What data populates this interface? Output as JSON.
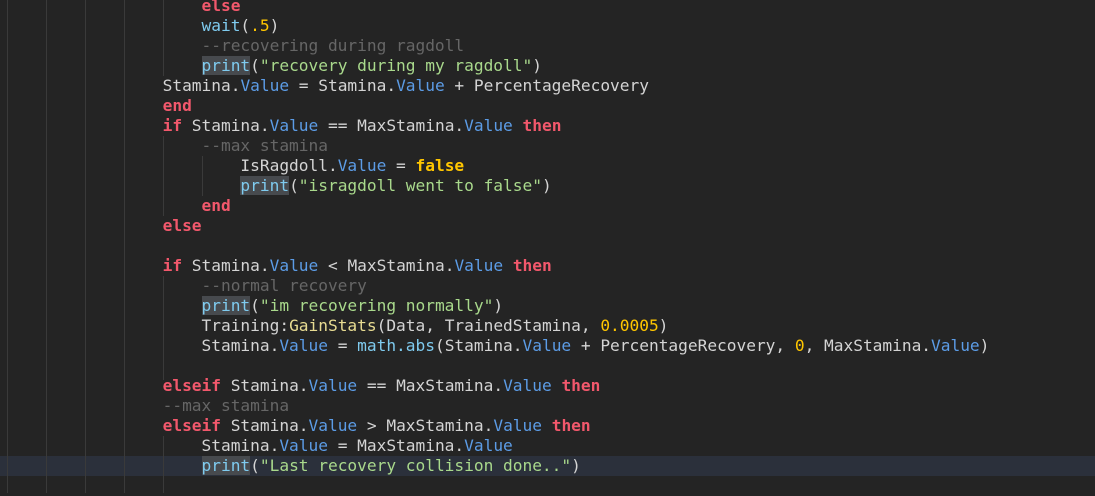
{
  "editor": {
    "current_line": 23,
    "lines": [
      {
        "indent": 20,
        "tokens": [
          [
            "kw",
            "else"
          ]
        ]
      },
      {
        "indent": 20,
        "tokens": [
          [
            "fn",
            "wait"
          ],
          [
            "txt",
            "("
          ],
          [
            "num",
            ".5"
          ],
          [
            "txt",
            ")"
          ]
        ]
      },
      {
        "indent": 20,
        "tokens": [
          [
            "com",
            "--recovering during ragdoll"
          ]
        ]
      },
      {
        "indent": 20,
        "tokens": [
          [
            "fnhl",
            "print"
          ],
          [
            "txt",
            "("
          ],
          [
            "str",
            "\"recovery during my ragdoll\""
          ],
          [
            "txt",
            ")"
          ]
        ]
      },
      {
        "indent": 16,
        "tokens": [
          [
            "txt",
            "Stamina."
          ],
          [
            "prop",
            "Value"
          ],
          [
            "txt",
            " = Stamina."
          ],
          [
            "prop",
            "Value"
          ],
          [
            "txt",
            " + PercentageRecovery"
          ]
        ]
      },
      {
        "indent": 16,
        "tokens": [
          [
            "kw",
            "end"
          ]
        ]
      },
      {
        "indent": 16,
        "tokens": [
          [
            "kw",
            "if"
          ],
          [
            "txt",
            " Stamina."
          ],
          [
            "prop",
            "Value"
          ],
          [
            "txt",
            " == MaxStamina."
          ],
          [
            "prop",
            "Value"
          ],
          [
            "txt",
            " "
          ],
          [
            "kw",
            "then"
          ]
        ]
      },
      {
        "indent": 20,
        "tokens": [
          [
            "com",
            "--max stamina"
          ]
        ]
      },
      {
        "indent": 24,
        "tokens": [
          [
            "txt",
            "IsRagdoll."
          ],
          [
            "prop",
            "Value"
          ],
          [
            "txt",
            " = "
          ],
          [
            "bool",
            "false"
          ]
        ]
      },
      {
        "indent": 24,
        "tokens": [
          [
            "fnhl",
            "print"
          ],
          [
            "txt",
            "("
          ],
          [
            "str",
            "\"isragdoll went to false\""
          ],
          [
            "txt",
            ")"
          ]
        ]
      },
      {
        "indent": 20,
        "tokens": [
          [
            "kw",
            "end"
          ]
        ]
      },
      {
        "indent": 16,
        "tokens": [
          [
            "kw",
            "else"
          ]
        ]
      },
      {
        "indent": 0,
        "tokens": []
      },
      {
        "indent": 16,
        "tokens": [
          [
            "kw",
            "if"
          ],
          [
            "txt",
            " Stamina."
          ],
          [
            "prop",
            "Value"
          ],
          [
            "txt",
            " < MaxStamina."
          ],
          [
            "prop",
            "Value"
          ],
          [
            "txt",
            " "
          ],
          [
            "kw",
            "then"
          ]
        ]
      },
      {
        "indent": 20,
        "tokens": [
          [
            "com",
            "--normal recovery"
          ]
        ]
      },
      {
        "indent": 20,
        "tokens": [
          [
            "fnhl",
            "print"
          ],
          [
            "txt",
            "("
          ],
          [
            "str",
            "\"im recovering normally\""
          ],
          [
            "txt",
            ")"
          ]
        ]
      },
      {
        "indent": 20,
        "tokens": [
          [
            "txt",
            "Training:"
          ],
          [
            "meth",
            "GainStats"
          ],
          [
            "txt",
            "(Data, TrainedStamina, "
          ],
          [
            "num",
            "0.0005"
          ],
          [
            "txt",
            ")"
          ]
        ]
      },
      {
        "indent": 20,
        "tokens": [
          [
            "txt",
            "Stamina."
          ],
          [
            "prop",
            "Value"
          ],
          [
            "txt",
            " = "
          ],
          [
            "fn",
            "math.abs"
          ],
          [
            "txt",
            "(Stamina."
          ],
          [
            "prop",
            "Value"
          ],
          [
            "txt",
            " + PercentageRecovery, "
          ],
          [
            "num",
            "0"
          ],
          [
            "txt",
            ", MaxStamina."
          ],
          [
            "prop",
            "Value"
          ],
          [
            "txt",
            ")"
          ]
        ]
      },
      {
        "indent": 0,
        "tokens": []
      },
      {
        "indent": 16,
        "tokens": [
          [
            "kw",
            "elseif"
          ],
          [
            "txt",
            " Stamina."
          ],
          [
            "prop",
            "Value"
          ],
          [
            "txt",
            " == MaxStamina."
          ],
          [
            "prop",
            "Value"
          ],
          [
            "txt",
            " "
          ],
          [
            "kw",
            "then"
          ]
        ]
      },
      {
        "indent": 16,
        "tokens": [
          [
            "com",
            "--max stamina"
          ]
        ]
      },
      {
        "indent": 16,
        "tokens": [
          [
            "kw",
            "elseif"
          ],
          [
            "txt",
            " Stamina."
          ],
          [
            "prop",
            "Value"
          ],
          [
            "txt",
            " > MaxStamina."
          ],
          [
            "prop",
            "Value"
          ],
          [
            "txt",
            " "
          ],
          [
            "kw",
            "then"
          ]
        ]
      },
      {
        "indent": 20,
        "tokens": [
          [
            "txt",
            "Stamina."
          ],
          [
            "prop",
            "Value"
          ],
          [
            "txt",
            " = MaxStamina."
          ],
          [
            "prop",
            "Value"
          ]
        ]
      },
      {
        "indent": 20,
        "tokens": [
          [
            "fnhl",
            "print"
          ],
          [
            "txt",
            "("
          ],
          [
            "str",
            "\"Last recovery collision done..\""
          ],
          [
            "txt",
            ")"
          ]
        ]
      },
      {
        "indent": 0,
        "tokens": []
      }
    ]
  }
}
